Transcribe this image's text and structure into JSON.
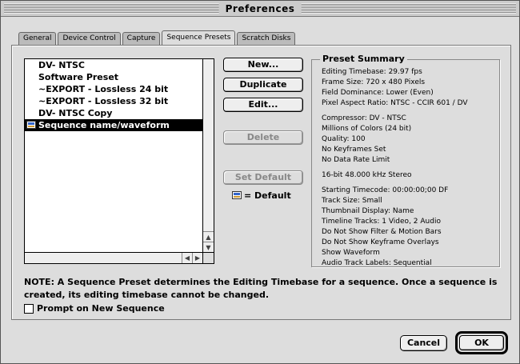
{
  "window": {
    "title": "Preferences"
  },
  "tabs": [
    {
      "label": "General"
    },
    {
      "label": "Device Control"
    },
    {
      "label": "Capture"
    },
    {
      "label": "Sequence Presets",
      "active": true
    },
    {
      "label": "Scratch Disks"
    }
  ],
  "presets": {
    "items": [
      "DV- NTSC",
      "Software Preset",
      "~EXPORT - Lossless 24 bit",
      "~EXPORT - Lossless 32 bit",
      "DV- NTSC Copy",
      "Sequence name/waveform"
    ],
    "selected_index": 5
  },
  "buttons": {
    "new": "New...",
    "duplicate": "Duplicate",
    "edit": "Edit...",
    "delete": "Delete",
    "set_default": "Set Default"
  },
  "default_legend": "= Default",
  "summary": {
    "title": "Preset Summary",
    "lines": [
      "Editing Timebase: 29.97 fps",
      "Frame Size: 720 x 480 Pixels",
      "Field Dominance: Lower (Even)",
      "Pixel Aspect Ratio: NTSC - CCIR 601 / DV",
      "",
      "Compressor: DV - NTSC",
      "Millions of Colors (24 bit)",
      "Quality: 100",
      "No Keyframes Set",
      "No Data Rate Limit",
      "",
      "16-bit 48.000 kHz Stereo",
      "",
      "Starting Timecode: 00:00:00;00 DF",
      "Track Size: Small",
      "Thumbnail Display: Name",
      "Timeline Tracks: 1 Video, 2 Audio",
      "Do Not Show Filter & Motion Bars",
      "Do Not Show Keyframe Overlays",
      "Show Waveform",
      "Audio Track Labels: Sequential"
    ]
  },
  "note": "NOTE: A Sequence Preset determines the Editing Timebase for a sequence. Once a sequence is created, its editing timebase cannot be changed.",
  "prompt_checkbox": {
    "label": "Prompt on New Sequence",
    "checked": false
  },
  "footer": {
    "cancel": "Cancel",
    "ok": "OK"
  }
}
